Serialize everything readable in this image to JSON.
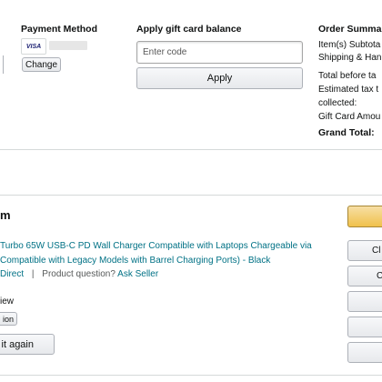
{
  "payment": {
    "heading": "Payment Method",
    "card_brand": "VISA",
    "change_label": "Change"
  },
  "gift_card": {
    "heading": "Apply gift card balance",
    "placeholder": "Enter code",
    "apply_label": "Apply"
  },
  "summary": {
    "heading": "Order Summa",
    "rows": [
      "Item(s) Subtota",
      "Shipping & Han",
      "Total before ta",
      "Estimated tax t",
      "collected:",
      "Gift Card Amou"
    ],
    "grand_total_label": "Grand Total:"
  },
  "item": {
    "section_title": "m",
    "title_line1": "Turbo 65W USB-C PD Wall Charger Compatible with Laptops Chargeable via",
    "title_line2_link": "Compatible with Legacy Models with Barrel Charging Ports) -",
    "title_line2_color": "Black",
    "sold_by": "Direct",
    "product_question": "Product question?",
    "ask_seller": "Ask Seller",
    "review_label": "iew",
    "condition_button": "ion",
    "buy_again_button": "it again"
  },
  "side_buttons": [
    "Cl",
    "C",
    "",
    "",
    ""
  ],
  "colors": {
    "accent_yellow": "#f0c14b",
    "link": "#007185",
    "divider": "#d5d9d9"
  }
}
